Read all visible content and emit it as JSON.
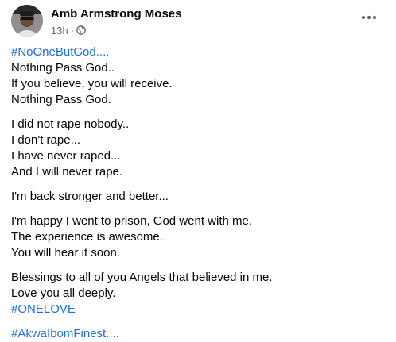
{
  "post": {
    "author_name": "Amb Armstrong Moses",
    "timestamp": "13h",
    "separator": "·",
    "privacy_icon": "globe-icon",
    "more_icon": "more-horizontal-icon",
    "hashtag_color": "#216fdb",
    "hashtag_top": "#NoOneButGod....",
    "paragraphs": [
      [
        "Nothing Pass God..",
        "If you believe, you will receive.",
        "Nothing Pass God."
      ],
      [
        "I did not rape nobody..",
        "I don't rape...",
        "I have never raped...",
        "And I will never rape."
      ],
      [
        "I'm back stronger and better..."
      ],
      [
        "I'm happy I went to prison, God went with me.",
        "The experience is awesome.",
        "You will hear it soon."
      ],
      [
        "Blessings to all of you Angels that believed in me.",
        "Love you all deeply."
      ]
    ],
    "hashtag_onelove": "#ONELOVE",
    "hashtag_bottom": "#AkwaIbomFinest...."
  }
}
